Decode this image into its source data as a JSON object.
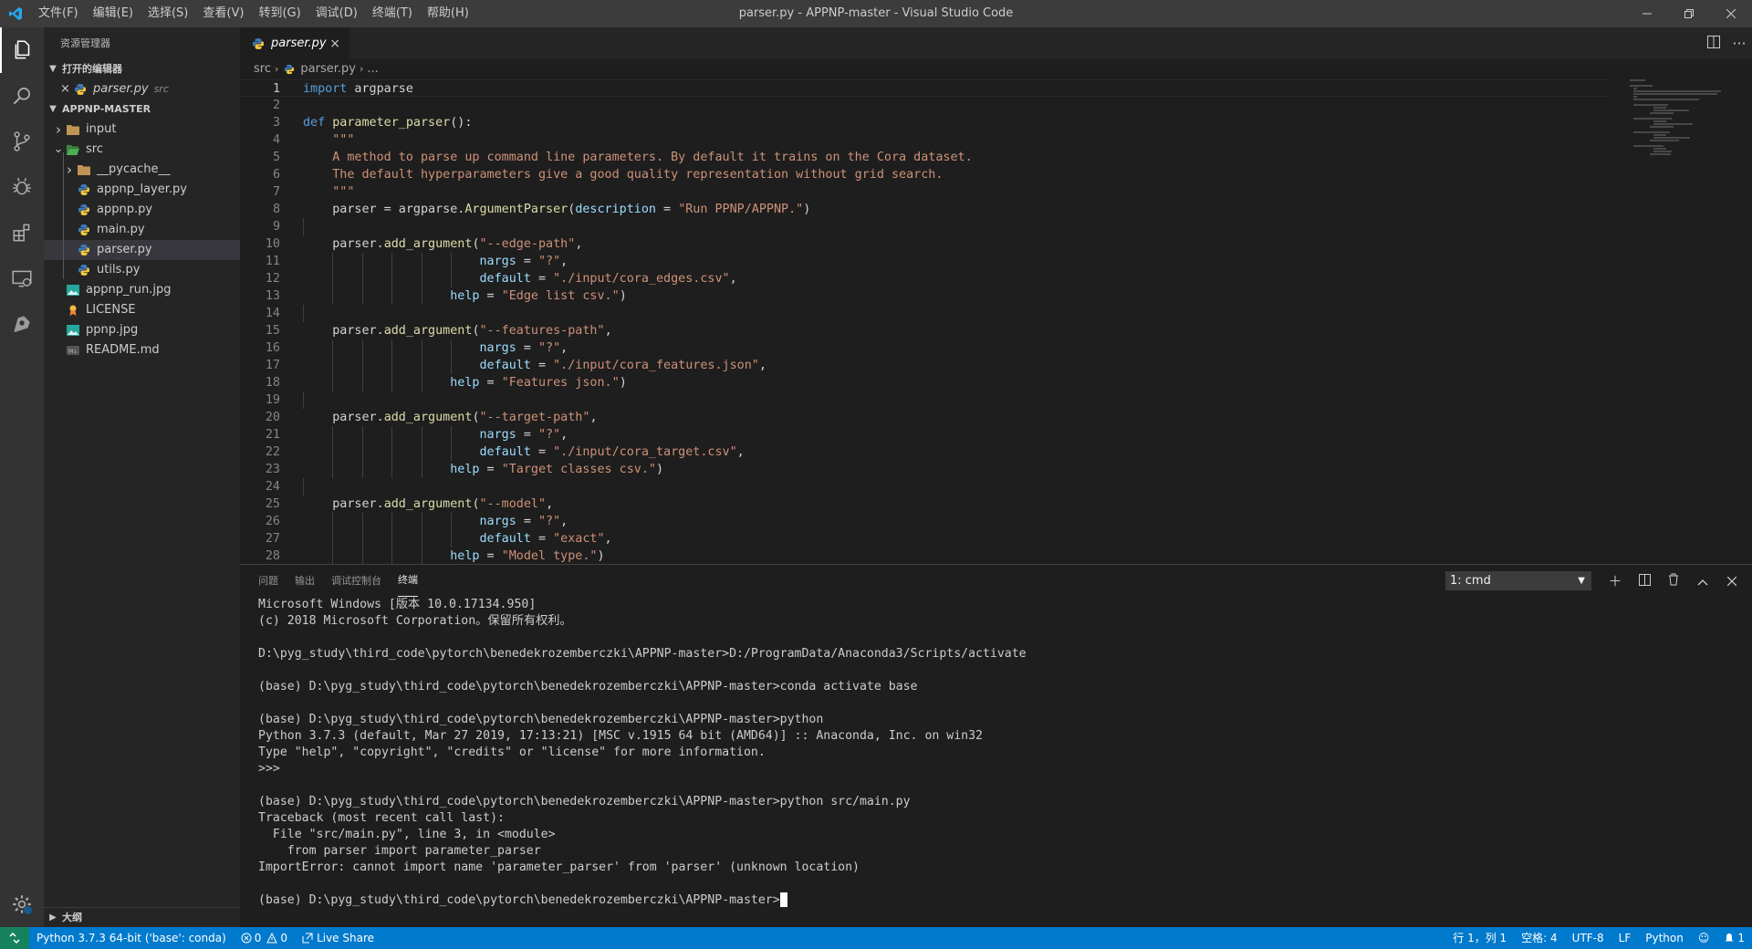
{
  "window": {
    "title": "parser.py - APPNP-master - Visual Studio Code",
    "menus": [
      "文件(F)",
      "编辑(E)",
      "选择(S)",
      "查看(V)",
      "转到(G)",
      "调试(D)",
      "终端(T)",
      "帮助(H)"
    ],
    "accent": "#007acc"
  },
  "activity_bar": {
    "items": [
      "explorer-icon",
      "search-icon",
      "source-control-icon",
      "debug-icon",
      "extensions-icon",
      "remote-explorer-icon",
      "live-share-icon"
    ],
    "bottom": "settings-gear-icon"
  },
  "sidebar": {
    "title": "资源管理器",
    "open_editors_label": "打开的编辑器",
    "open_editor": {
      "name": "parser.py",
      "dir": "src"
    },
    "root_label": "APPNP-MASTER",
    "tree": [
      {
        "name": "input",
        "type": "folder",
        "depth": 0
      },
      {
        "name": "src",
        "type": "folder-open",
        "depth": 0
      },
      {
        "name": "__pycache__",
        "type": "folder",
        "depth": 1
      },
      {
        "name": "appnp_layer.py",
        "type": "python",
        "depth": 1
      },
      {
        "name": "appnp.py",
        "type": "python",
        "depth": 1
      },
      {
        "name": "main.py",
        "type": "python",
        "depth": 1
      },
      {
        "name": "parser.py",
        "type": "python",
        "depth": 1,
        "selected": true
      },
      {
        "name": "utils.py",
        "type": "python",
        "depth": 1
      },
      {
        "name": "appnp_run.jpg",
        "type": "image",
        "depth": 0
      },
      {
        "name": "LICENSE",
        "type": "license",
        "depth": 0
      },
      {
        "name": "ppnp.jpg",
        "type": "image",
        "depth": 0
      },
      {
        "name": "README.md",
        "type": "markdown",
        "depth": 0
      }
    ],
    "outline_label": "大纲"
  },
  "editor": {
    "tab_label": "parser.py",
    "breadcrumb": [
      "src",
      "parser.py",
      "..."
    ],
    "lines": [
      "import argparse",
      "",
      "def parameter_parser():",
      "    \"\"\"",
      "    A method to parse up command line parameters. By default it trains on the Cora dataset.",
      "    The default hyperparameters give a good quality representation without grid search.",
      "    \"\"\"",
      "    parser = argparse.ArgumentParser(description = \"Run PPNP/APPNP.\")",
      "",
      "    parser.add_argument(\"--edge-path\",",
      "                        nargs = \"?\",",
      "                        default = \"./input/cora_edges.csv\",",
      "                    help = \"Edge list csv.\")",
      "",
      "    parser.add_argument(\"--features-path\",",
      "                        nargs = \"?\",",
      "                        default = \"./input/cora_features.json\",",
      "                    help = \"Features json.\")",
      "",
      "    parser.add_argument(\"--target-path\",",
      "                        nargs = \"?\",",
      "                        default = \"./input/cora_target.csv\",",
      "                    help = \"Target classes csv.\")",
      "",
      "    parser.add_argument(\"--model\",",
      "                        nargs = \"?\",",
      "                        default = \"exact\",",
      "                    help = \"Model type.\")"
    ]
  },
  "panel": {
    "tabs": [
      "问题",
      "输出",
      "调试控制台",
      "终端"
    ],
    "active_tab": "终端",
    "terminal_select": "1: cmd",
    "terminal_lines": [
      "Microsoft Windows [版本 10.0.17134.950]",
      "(c) 2018 Microsoft Corporation。保留所有权利。",
      "",
      "D:\\pyg_study\\third_code\\pytorch\\benedekrozemberczki\\APPNP-master>D:/ProgramData/Anaconda3/Scripts/activate",
      "",
      "(base) D:\\pyg_study\\third_code\\pytorch\\benedekrozemberczki\\APPNP-master>conda activate base",
      "",
      "(base) D:\\pyg_study\\third_code\\pytorch\\benedekrozemberczki\\APPNP-master>python",
      "Python 3.7.3 (default, Mar 27 2019, 17:13:21) [MSC v.1915 64 bit (AMD64)] :: Anaconda, Inc. on win32",
      "Type \"help\", \"copyright\", \"credits\" or \"license\" for more information.",
      ">>>",
      "",
      "(base) D:\\pyg_study\\third_code\\pytorch\\benedekrozemberczki\\APPNP-master>python src/main.py",
      "Traceback (most recent call last):",
      "  File \"src/main.py\", line 3, in <module>",
      "    from parser import parameter_parser",
      "ImportError: cannot import name 'parameter_parser' from 'parser' (unknown location)",
      "",
      "(base) D:\\pyg_study\\third_code\\pytorch\\benedekrozemberczki\\APPNP-master>"
    ]
  },
  "statusbar": {
    "python": "Python 3.7.3 64-bit ('base': conda)",
    "errors": "0",
    "warnings": "0",
    "live_share": "Live Share",
    "position": "行 1，列 1",
    "spaces": "空格: 4",
    "encoding": "UTF-8",
    "eol": "LF",
    "language": "Python",
    "notifications": "1"
  }
}
